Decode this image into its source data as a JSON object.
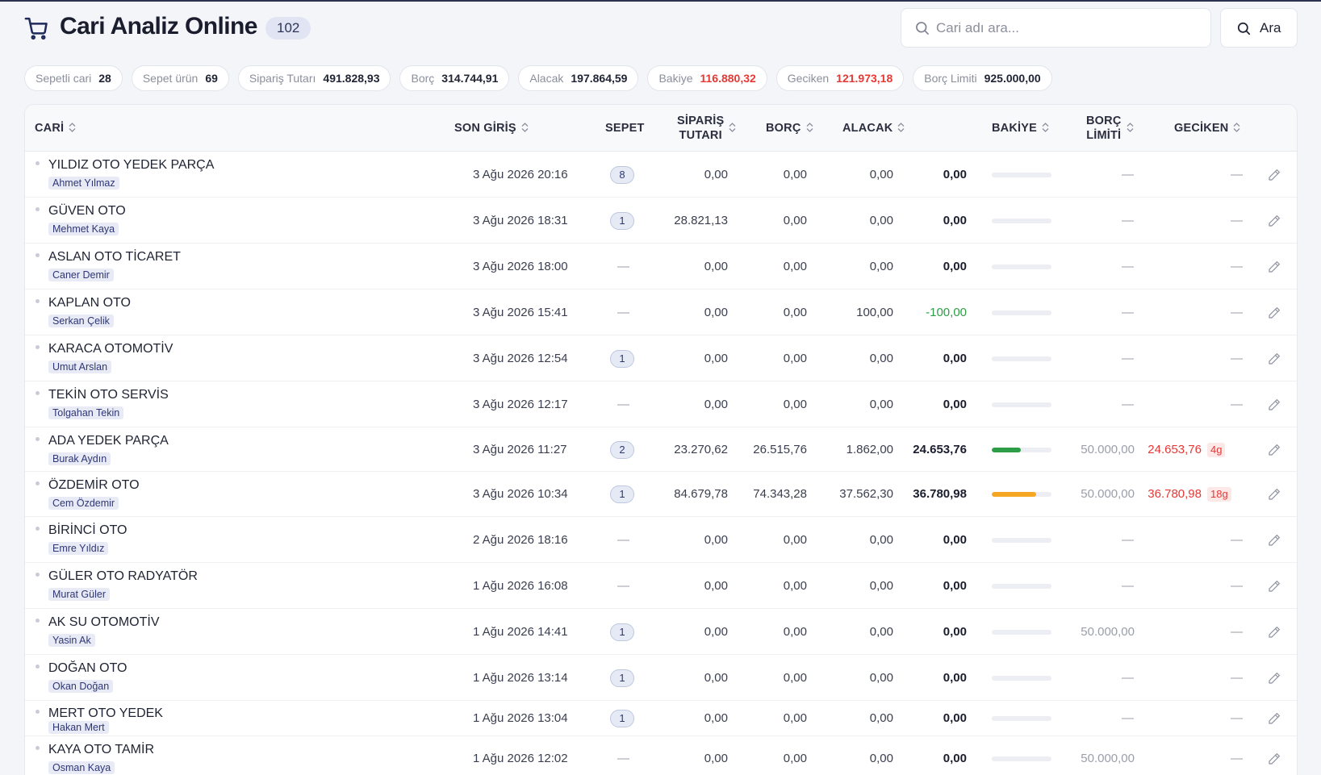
{
  "header": {
    "title": "Cari Analiz Online",
    "count": "102",
    "search_placeholder": "Cari adı ara...",
    "search_button": "Ara"
  },
  "stats": [
    {
      "label": "Sepetli cari",
      "value": "28",
      "color": "#1f2333"
    },
    {
      "label": "Sepet ürün",
      "value": "69",
      "color": "#1f2333"
    },
    {
      "label": "Sipariş Tutarı",
      "value": "491.828,93",
      "color": "#1f2333"
    },
    {
      "label": "Borç",
      "value": "314.744,91",
      "color": "#1f2333"
    },
    {
      "label": "Alacak",
      "value": "197.864,59",
      "color": "#1f2333"
    },
    {
      "label": "Bakiye",
      "value": "116.880,32",
      "color": "#e53935"
    },
    {
      "label": "Geciken",
      "value": "121.973,18",
      "color": "#e53935"
    },
    {
      "label": "Borç Limiti",
      "value": "925.000,00",
      "color": "#1f2333"
    }
  ],
  "table": {
    "headers": {
      "cari": "CARİ",
      "son_giris": "SON GİRİŞ",
      "sepet": "SEPET",
      "siparis_1": "SİPARİŞ",
      "siparis_2": "TUTARI",
      "borc": "BORÇ",
      "alacak": "ALACAK",
      "bakiye": "BAKİYE",
      "limit_1": "BORÇ",
      "limit_2": "LİMİTİ",
      "geciken": "GECİKEN"
    },
    "rows": [
      {
        "name": "YILDIZ OTO YEDEK PARÇA",
        "rep": "Ahmet Yılmaz",
        "date": "3 Ağu 2026 20:16",
        "sepet": "8",
        "siparis": "0,00",
        "borc": "0,00",
        "alacak": "0,00",
        "bakiye": "0,00",
        "bakiye_status": "normal",
        "usage": 0,
        "usage_color": "",
        "limit": "—",
        "geciken": "—",
        "days": ""
      },
      {
        "name": "GÜVEN OTO",
        "rep": "Mehmet Kaya",
        "date": "3 Ağu 2026 18:31",
        "sepet": "1",
        "siparis": "28.821,13",
        "borc": "0,00",
        "alacak": "0,00",
        "bakiye": "0,00",
        "bakiye_status": "normal",
        "usage": 0,
        "usage_color": "",
        "limit": "—",
        "geciken": "—",
        "days": ""
      },
      {
        "name": "ASLAN OTO TİCARET",
        "rep": "Caner Demir",
        "date": "3 Ağu 2026 18:00",
        "sepet": "—",
        "siparis": "0,00",
        "borc": "0,00",
        "alacak": "0,00",
        "bakiye": "0,00",
        "bakiye_status": "normal",
        "usage": 0,
        "usage_color": "",
        "limit": "—",
        "geciken": "—",
        "days": ""
      },
      {
        "name": "KAPLAN OTO",
        "rep": "Serkan Çelik",
        "date": "3 Ağu 2026 15:41",
        "sepet": "—",
        "siparis": "0,00",
        "borc": "0,00",
        "alacak": "100,00",
        "bakiye": "-100,00",
        "bakiye_status": "credit",
        "usage": 0,
        "usage_color": "",
        "limit": "—",
        "geciken": "—",
        "days": ""
      },
      {
        "name": "KARACA OTOMOTİV",
        "rep": "Umut Arslan",
        "date": "3 Ağu 2026 12:54",
        "sepet": "1",
        "siparis": "0,00",
        "borc": "0,00",
        "alacak": "0,00",
        "bakiye": "0,00",
        "bakiye_status": "normal",
        "usage": 0,
        "usage_color": "",
        "limit": "—",
        "geciken": "—",
        "days": ""
      },
      {
        "name": "TEKİN OTO SERVİS",
        "rep": "Tolgahan Tekin",
        "date": "3 Ağu 2026 12:17",
        "sepet": "—",
        "siparis": "0,00",
        "borc": "0,00",
        "alacak": "0,00",
        "bakiye": "0,00",
        "bakiye_status": "normal",
        "usage": 0,
        "usage_color": "",
        "limit": "—",
        "geciken": "—",
        "days": ""
      },
      {
        "name": "ADA YEDEK PARÇA",
        "rep": "Burak Aydın",
        "date": "3 Ağu 2026 11:27",
        "sepet": "2",
        "siparis": "23.270,62",
        "borc": "26.515,76",
        "alacak": "1.862,00",
        "bakiye": "24.653,76",
        "bakiye_status": "normal",
        "usage": 0.49,
        "usage_color": "#2e9d47",
        "limit": "50.000,00",
        "geciken": "24.653,76",
        "days": "4g"
      },
      {
        "name": "ÖZDEMİR OTO",
        "rep": "Cem Özdemir",
        "date": "3 Ağu 2026 10:34",
        "sepet": "1",
        "siparis": "84.679,78",
        "borc": "74.343,28",
        "alacak": "37.562,30",
        "bakiye": "36.780,98",
        "bakiye_status": "normal",
        "usage": 0.74,
        "usage_color": "#f5a623",
        "limit": "50.000,00",
        "geciken": "36.780,98",
        "days": "18g"
      },
      {
        "name": "BİRİNCİ OTO",
        "rep": "Emre Yıldız",
        "date": "2 Ağu 2026 18:16",
        "sepet": "—",
        "siparis": "0,00",
        "borc": "0,00",
        "alacak": "0,00",
        "bakiye": "0,00",
        "bakiye_status": "normal",
        "usage": 0,
        "usage_color": "",
        "limit": "—",
        "geciken": "—",
        "days": ""
      },
      {
        "name": "GÜLER OTO RADYATÖR",
        "rep": "Murat Güler",
        "date": "1 Ağu 2026 16:08",
        "sepet": "—",
        "siparis": "0,00",
        "borc": "0,00",
        "alacak": "0,00",
        "bakiye": "0,00",
        "bakiye_status": "normal",
        "usage": 0,
        "usage_color": "",
        "limit": "—",
        "geciken": "—",
        "days": ""
      },
      {
        "name": "AK SU OTOMOTİV",
        "rep": "Yasin Ak",
        "date": "1 Ağu 2026 14:41",
        "sepet": "1",
        "siparis": "0,00",
        "borc": "0,00",
        "alacak": "0,00",
        "bakiye": "0,00",
        "bakiye_status": "normal",
        "usage": 0,
        "usage_color": "",
        "limit": "50.000,00",
        "geciken": "—",
        "days": ""
      },
      {
        "name": "DOĞAN OTO",
        "rep": "Okan Doğan",
        "date": "1 Ağu 2026 13:14",
        "sepet": "1",
        "siparis": "0,00",
        "borc": "0,00",
        "alacak": "0,00",
        "bakiye": "0,00",
        "bakiye_status": "normal",
        "usage": 0,
        "usage_color": "",
        "limit": "—",
        "geciken": "—",
        "days": ""
      },
      {
        "name": "MERT OTO YEDEK",
        "rep": "Hakan Mert",
        "date": "1 Ağu 2026 13:04",
        "sepet": "1",
        "siparis": "0,00",
        "borc": "0,00",
        "alacak": "0,00",
        "bakiye": "0,00",
        "bakiye_status": "normal",
        "usage": 0,
        "usage_color": "",
        "limit": "—",
        "geciken": "—",
        "days": ""
      },
      {
        "name": "KAYA OTO TAMİR",
        "rep": "Osman Kaya",
        "date": "1 Ağu 2026 12:02",
        "sepet": "—",
        "siparis": "0,00",
        "borc": "0,00",
        "alacak": "0,00",
        "bakiye": "0,00",
        "bakiye_status": "normal",
        "usage": 0,
        "usage_color": "",
        "limit": "50.000,00",
        "geciken": "—",
        "days": ""
      }
    ]
  },
  "icons": {
    "cart": "cart-icon",
    "search": "search-icon",
    "sort": "sort-icon",
    "edit": "pencil-icon"
  }
}
